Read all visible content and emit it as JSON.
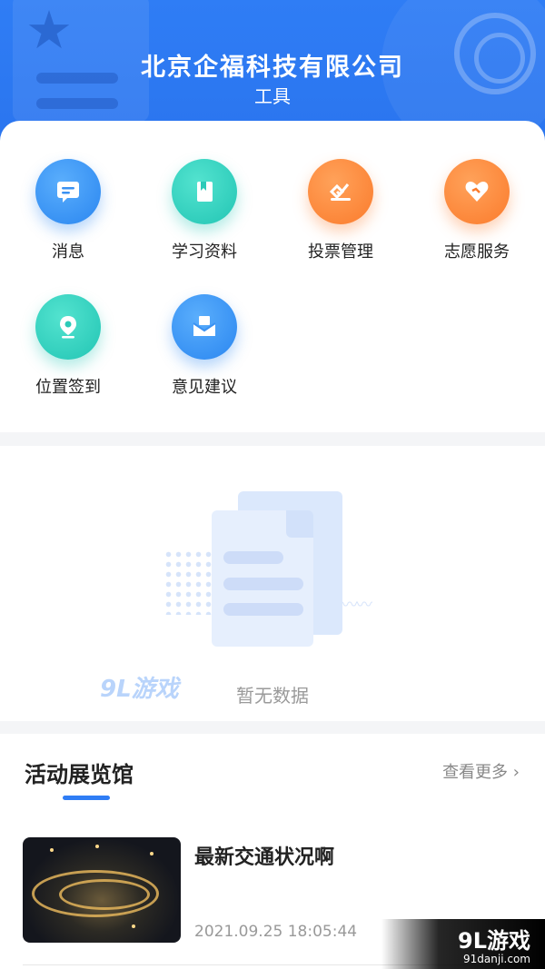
{
  "header": {
    "title": "北京企福科技有限公司",
    "subtitle": "工具",
    "watermark": "9L游戏"
  },
  "menu": {
    "items": [
      {
        "label": "消息",
        "icon": "message-icon",
        "color": "blue"
      },
      {
        "label": "学习资料",
        "icon": "book-icon",
        "color": "teal"
      },
      {
        "label": "投票管理",
        "icon": "vote-icon",
        "color": "orange"
      },
      {
        "label": "志愿服务",
        "icon": "heart-handshake-icon",
        "color": "orange"
      },
      {
        "label": "位置签到",
        "icon": "location-pin-icon",
        "color": "teal"
      },
      {
        "label": "意见建议",
        "icon": "mail-icon",
        "color": "blue"
      }
    ]
  },
  "empty_state": {
    "text": "暂无数据",
    "watermark": "9L游戏",
    "watermark_site": "91danji.com"
  },
  "activity": {
    "section_title": "活动展览馆",
    "more_label": "查看更多",
    "articles": [
      {
        "title": "最新交通状况啊",
        "time": "2021.09.25 18:05:44",
        "thumb": "night-city-interchange-image"
      }
    ]
  },
  "watermark": {
    "main": "9L游戏",
    "site": "91danji.com"
  },
  "colors": {
    "accent": "#2f7df5",
    "blue_icon": "#2a86f0",
    "teal_icon": "#22c5b4",
    "orange_icon": "#fb7b2c"
  }
}
